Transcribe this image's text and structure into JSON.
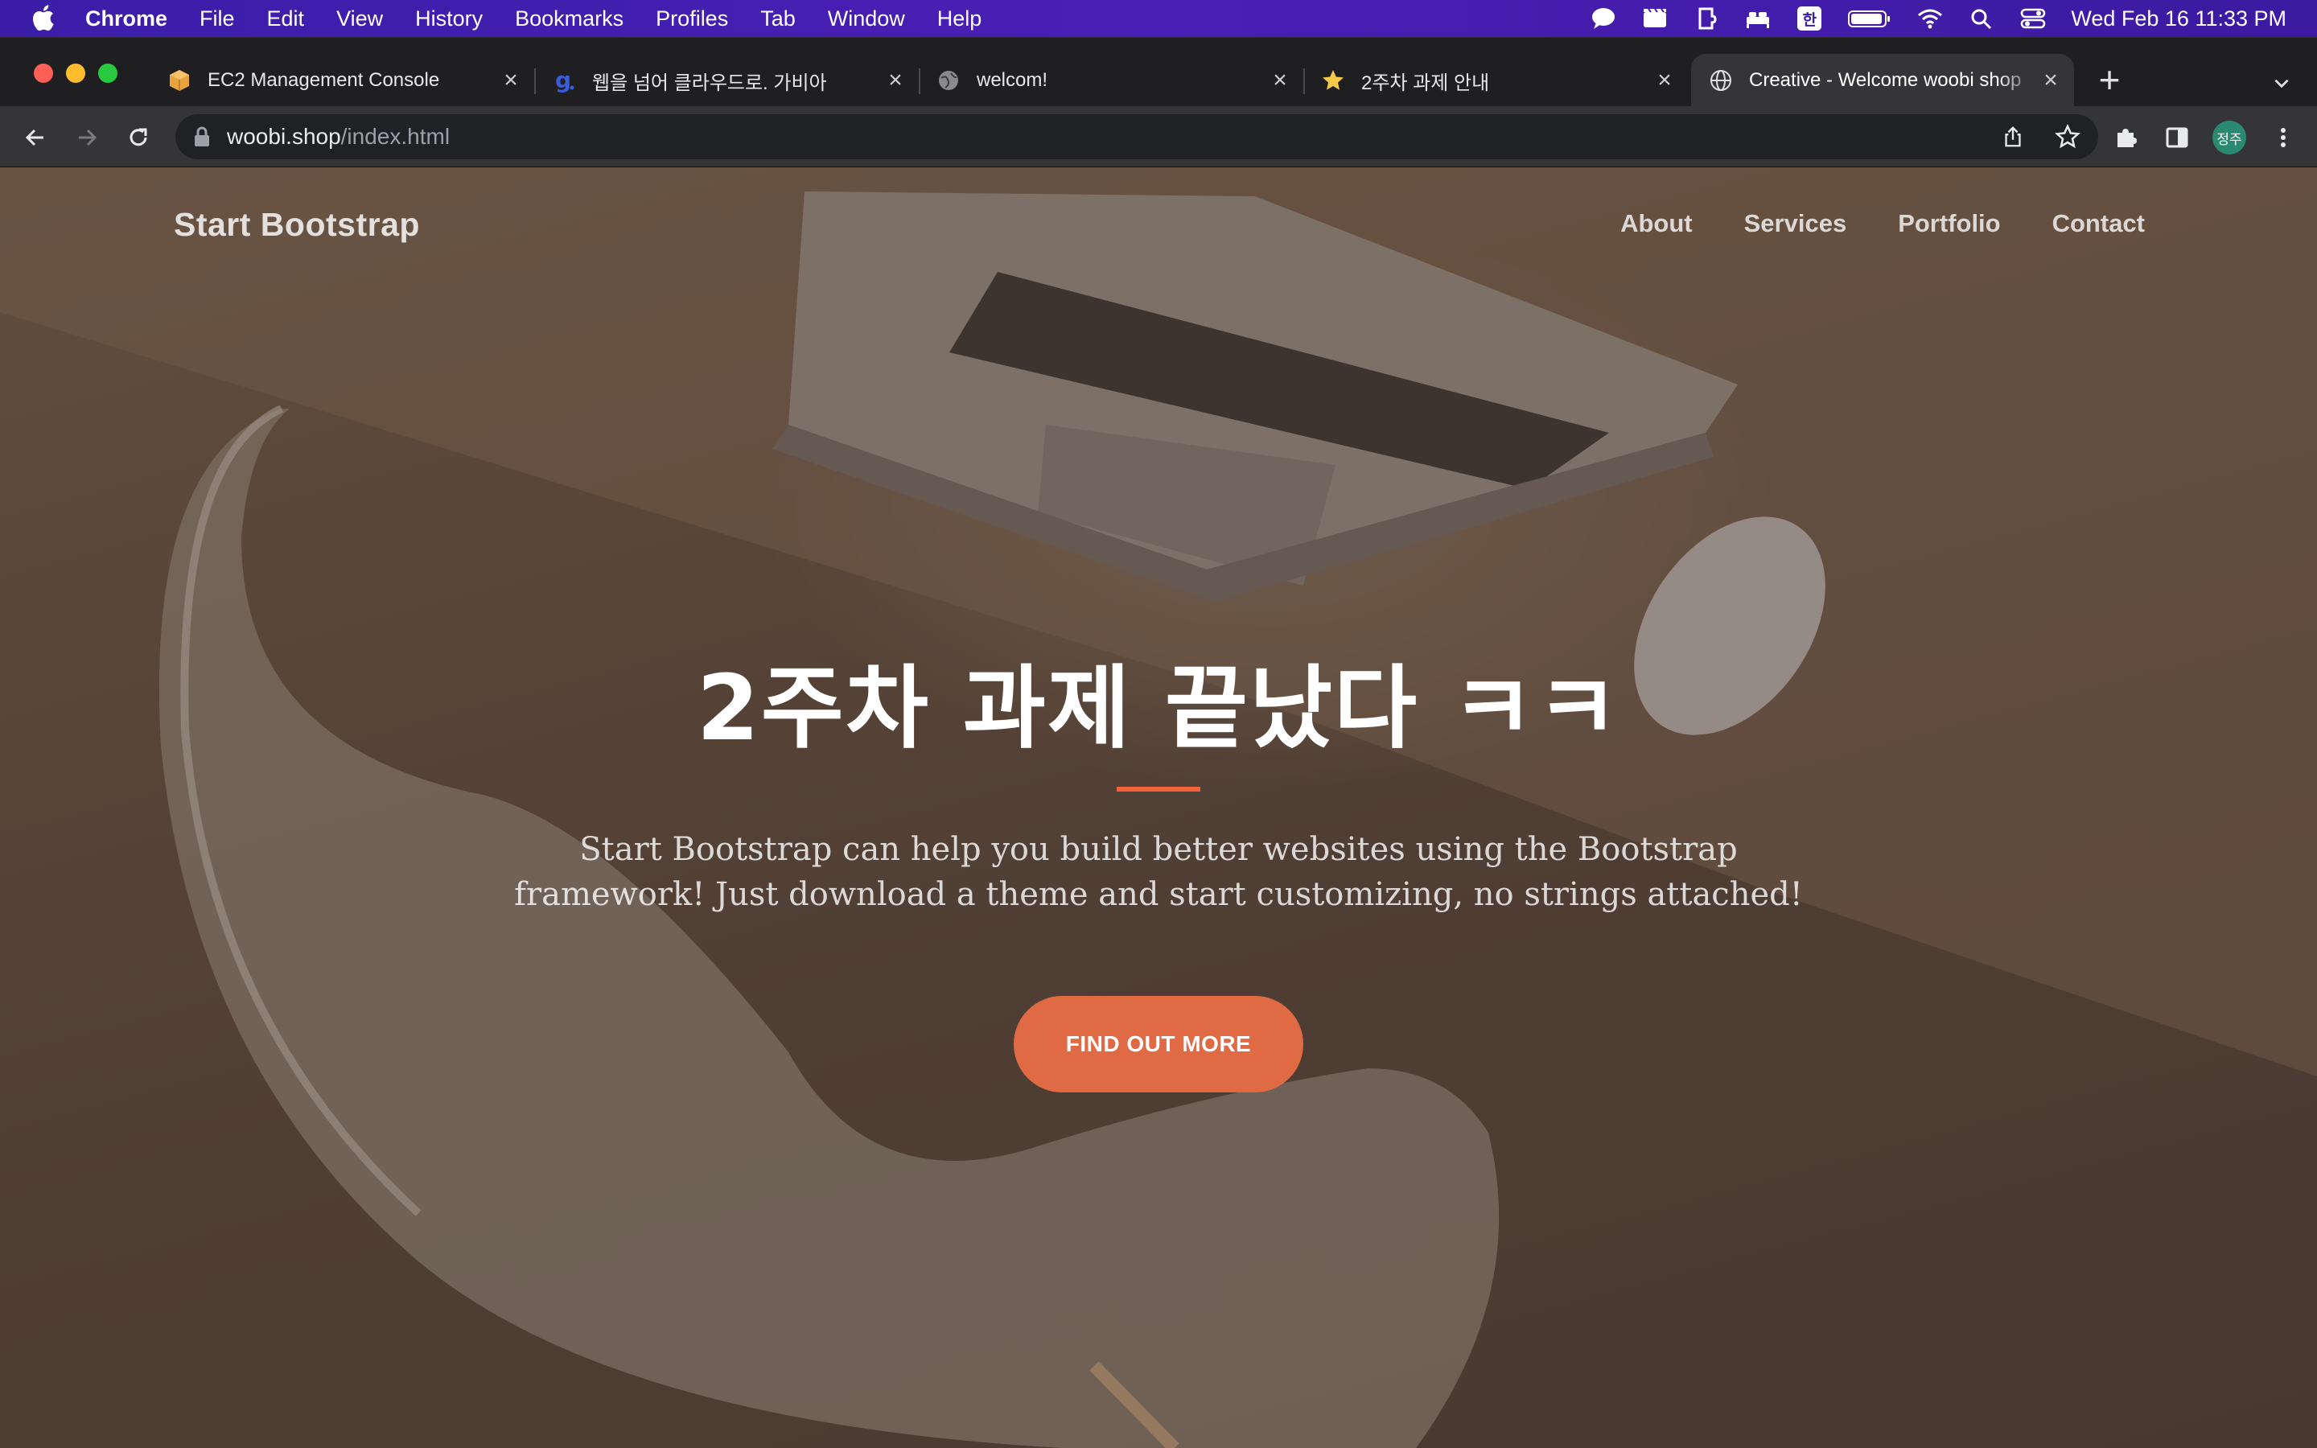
{
  "menubar": {
    "app_name": "Chrome",
    "menus": [
      "File",
      "Edit",
      "View",
      "History",
      "Bookmarks",
      "Profiles",
      "Tab",
      "Window",
      "Help"
    ],
    "ime_indicator": "한",
    "clock": "Wed Feb 16  11:33 PM",
    "status_icons": [
      "messages-icon",
      "clapper-icon",
      "extension-cube-icon",
      "bed-icon",
      "input-method-icon",
      "battery-icon",
      "wifi-icon",
      "spotlight-search-icon",
      "control-center-icon"
    ]
  },
  "tabs": [
    {
      "title": "EC2 Management Console",
      "favicon": "aws-cube-icon",
      "active": false
    },
    {
      "title": "웹을 넘어 클라우드로. 가비아",
      "favicon": "gabia-icon",
      "active": false
    },
    {
      "title": "welcom!",
      "favicon": "globe-icon",
      "active": false
    },
    {
      "title": "2주차 과제 안내",
      "favicon": "star-icon",
      "active": false
    },
    {
      "title": "Creative - Welcome woobi shop",
      "favicon": "globe-icon",
      "active": true
    }
  ],
  "toolbar": {
    "url_host": "woobi.shop",
    "url_path": "/index.html",
    "profile_initials": "정주"
  },
  "page": {
    "brand": "Start Bootstrap",
    "nav_links": [
      "About",
      "Services",
      "Portfolio",
      "Contact"
    ],
    "hero_title": "2주차 과제 끝났다 ㅋㅋ",
    "hero_lead": "Start Bootstrap can help you build better websites using the Bootstrap framework! Just download a theme and start customizing, no strings attached!",
    "cta_label": "FIND OUT MORE",
    "accent_color": "#f4623a"
  }
}
